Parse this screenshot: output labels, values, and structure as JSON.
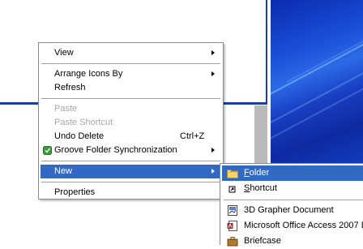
{
  "context_menu": {
    "view": "View",
    "arrange_icons_by": "Arrange Icons By",
    "refresh": "Refresh",
    "paste": "Paste",
    "paste_shortcut": "Paste Shortcut",
    "undo_delete": "Undo Delete",
    "undo_delete_shortcut": "Ctrl+Z",
    "groove_sync": "Groove Folder Synchronization",
    "new": "New",
    "properties": "Properties"
  },
  "new_submenu": {
    "folder_rest": "older",
    "folder_accel": "F",
    "shortcut_rest": "hortcut",
    "shortcut_accel": "S",
    "grapher_doc": "3D Grapher Document",
    "access_db": "Microsoft Office Access 2007 D",
    "briefcase": "Briefcase"
  },
  "colors": {
    "selection": "#316ac5",
    "window_border": "#1d3f9c",
    "disabled_text": "#a7a7a7"
  },
  "icons": [
    "groove-sync-icon",
    "folder-icon",
    "shortcut-icon",
    "grapher-icon",
    "access-icon",
    "briefcase-icon"
  ]
}
